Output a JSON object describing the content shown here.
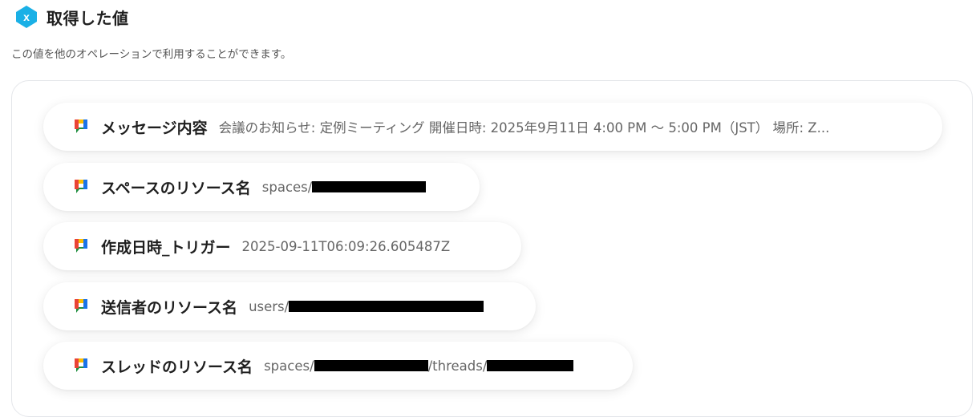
{
  "header": {
    "title": "取得した値"
  },
  "subtitle": "この値を他のオペレーションで利用することができます。",
  "items": [
    {
      "label": "メッセージ内容",
      "value": "会議のお知らせ: 定例ミーティング 開催日時: 2025年9月11日 4:00 PM 〜 5:00 PM（JST） 場所: Z..."
    },
    {
      "label": "スペースのリソース名",
      "value_prefix": "spaces/"
    },
    {
      "label": "作成日時_トリガー",
      "value": "2025-09-11T06:09:26.605487Z"
    },
    {
      "label": "送信者のリソース名",
      "value_prefix": "users/"
    },
    {
      "label": "スレッドのリソース名",
      "value_prefix": "spaces/",
      "value_middle": "/threads/"
    }
  ],
  "icons": {
    "header": "yoom-logo-icon",
    "item": "google-chat-icon"
  },
  "colors": {
    "logo": "#1ab0e6",
    "chat_green": "#1e8e3e",
    "chat_blue": "#1a73e8",
    "chat_yellow": "#fbbc04",
    "chat_red": "#ea4335"
  }
}
